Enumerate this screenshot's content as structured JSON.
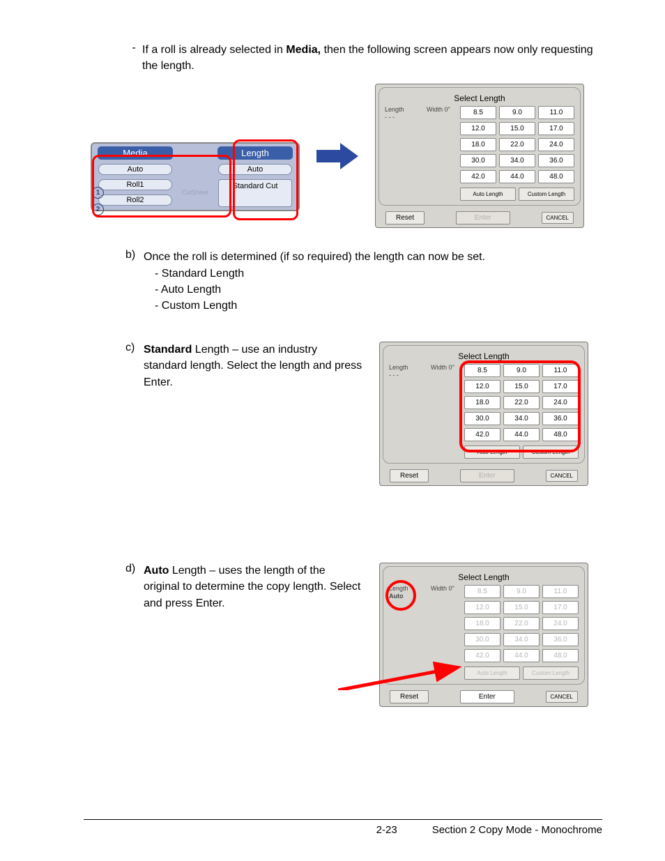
{
  "intro": {
    "text_a": "If a roll is already selected in ",
    "bold": "Media,",
    "text_b": " then the following screen appears now only requesting the length."
  },
  "media_panel": {
    "media_head": "Media",
    "length_head": "Length",
    "auto1": "Auto",
    "auto2": "Auto",
    "roll1": "Roll1",
    "roll2": "Roll2",
    "cutsheet": "CutSheet",
    "standard_cut": "Standard Cut",
    "num1": "1",
    "num2": "2"
  },
  "dialog": {
    "title": "Select Length",
    "width_label": "Width 0\"",
    "length_label": "Length",
    "dash": "- - -",
    "auto_word": "Auto",
    "lengths": [
      "8.5",
      "9.0",
      "11.0",
      "12.0",
      "15.0",
      "17.0",
      "18.0",
      "22.0",
      "24.0",
      "30.0",
      "34.0",
      "36.0",
      "42.0",
      "44.0",
      "48.0"
    ],
    "auto_length": "Auto Length",
    "custom_length": "Custom Length",
    "reset": "Reset",
    "enter": "Enter",
    "cancel": "CANCEL"
  },
  "step_b": {
    "letter": "b)",
    "text": "Once the roll is determined (if so required) the length can now be set.",
    "l1": "- Standard Length",
    "l2": "- Auto Length",
    "l3": "- Custom Length"
  },
  "step_c": {
    "letter": "c)",
    "bold": "Standard",
    "text": " Length – use an industry standard length. Select the length and press Enter."
  },
  "step_d": {
    "letter": "d)",
    "bold": "Auto",
    "text": " Length – uses the length of the original to determine the copy length. Select and press Enter."
  },
  "footer": {
    "page": "2-23",
    "section": "Section 2    Copy Mode - Monochrome"
  }
}
